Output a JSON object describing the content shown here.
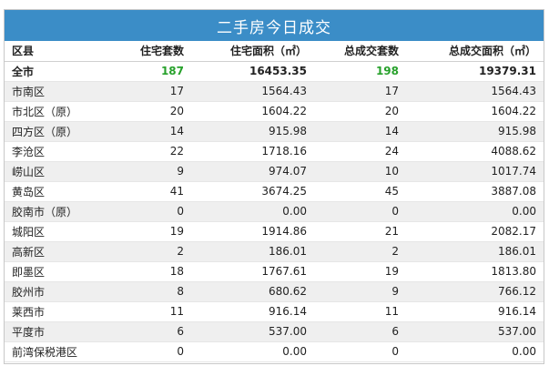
{
  "title": "二手房今日成交",
  "headers": [
    "区县",
    "住宅套数",
    "住宅面积（㎡）",
    "总成交套数",
    "总成交面积（㎡）"
  ],
  "total": {
    "district": "全市",
    "units": "187",
    "area": "16453.35",
    "total_units": "198",
    "total_area": "19379.31"
  },
  "rows": [
    {
      "district": "市南区",
      "units": "17",
      "area": "1564.43",
      "total_units": "17",
      "total_area": "1564.43"
    },
    {
      "district": "市北区（原）",
      "units": "20",
      "area": "1604.22",
      "total_units": "20",
      "total_area": "1604.22"
    },
    {
      "district": "四方区（原）",
      "units": "14",
      "area": "915.98",
      "total_units": "14",
      "total_area": "915.98"
    },
    {
      "district": "李沧区",
      "units": "22",
      "area": "1718.16",
      "total_units": "24",
      "total_area": "4088.62"
    },
    {
      "district": "崂山区",
      "units": "9",
      "area": "974.07",
      "total_units": "10",
      "total_area": "1017.74"
    },
    {
      "district": "黄岛区",
      "units": "41",
      "area": "3674.25",
      "total_units": "45",
      "total_area": "3887.08"
    },
    {
      "district": "胶南市（原）",
      "units": "0",
      "area": "0.00",
      "total_units": "0",
      "total_area": "0.00"
    },
    {
      "district": "城阳区",
      "units": "19",
      "area": "1914.86",
      "total_units": "21",
      "total_area": "2082.17"
    },
    {
      "district": "高新区",
      "units": "2",
      "area": "186.01",
      "total_units": "2",
      "total_area": "186.01"
    },
    {
      "district": "即墨区",
      "units": "18",
      "area": "1767.61",
      "total_units": "19",
      "total_area": "1813.80"
    },
    {
      "district": "胶州市",
      "units": "8",
      "area": "680.62",
      "total_units": "9",
      "total_area": "766.12"
    },
    {
      "district": "莱西市",
      "units": "11",
      "area": "916.14",
      "total_units": "11",
      "total_area": "916.14"
    },
    {
      "district": "平度市",
      "units": "6",
      "area": "537.00",
      "total_units": "6",
      "total_area": "537.00"
    },
    {
      "district": "前湾保税港区",
      "units": "0",
      "area": "0.00",
      "total_units": "0",
      "total_area": "0.00"
    }
  ]
}
